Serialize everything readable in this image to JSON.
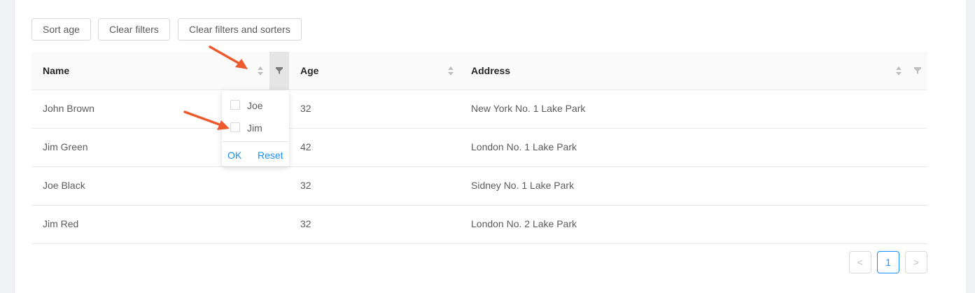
{
  "toolbar": {
    "sort_age": "Sort age",
    "clear_filters": "Clear filters",
    "clear_filters_and_sorters": "Clear filters and sorters"
  },
  "columns": {
    "name": "Name",
    "age": "Age",
    "address": "Address"
  },
  "rows": [
    {
      "name": "John Brown",
      "age": "32",
      "address": "New York No. 1 Lake Park"
    },
    {
      "name": "Jim Green",
      "age": "42",
      "address": "London No. 1 Lake Park"
    },
    {
      "name": "Joe Black",
      "age": "32",
      "address": "Sidney No. 1 Lake Park"
    },
    {
      "name": "Jim Red",
      "age": "32",
      "address": "London No. 2 Lake Park"
    }
  ],
  "filter_dropdown": {
    "options": [
      "Joe",
      "Jim"
    ],
    "ok": "OK",
    "reset": "Reset"
  },
  "pagination": {
    "prev": "<",
    "current_page": "1",
    "next": ">"
  },
  "colors": {
    "primary": "#1890ff",
    "annotation_arrow": "#ec5b2e"
  }
}
